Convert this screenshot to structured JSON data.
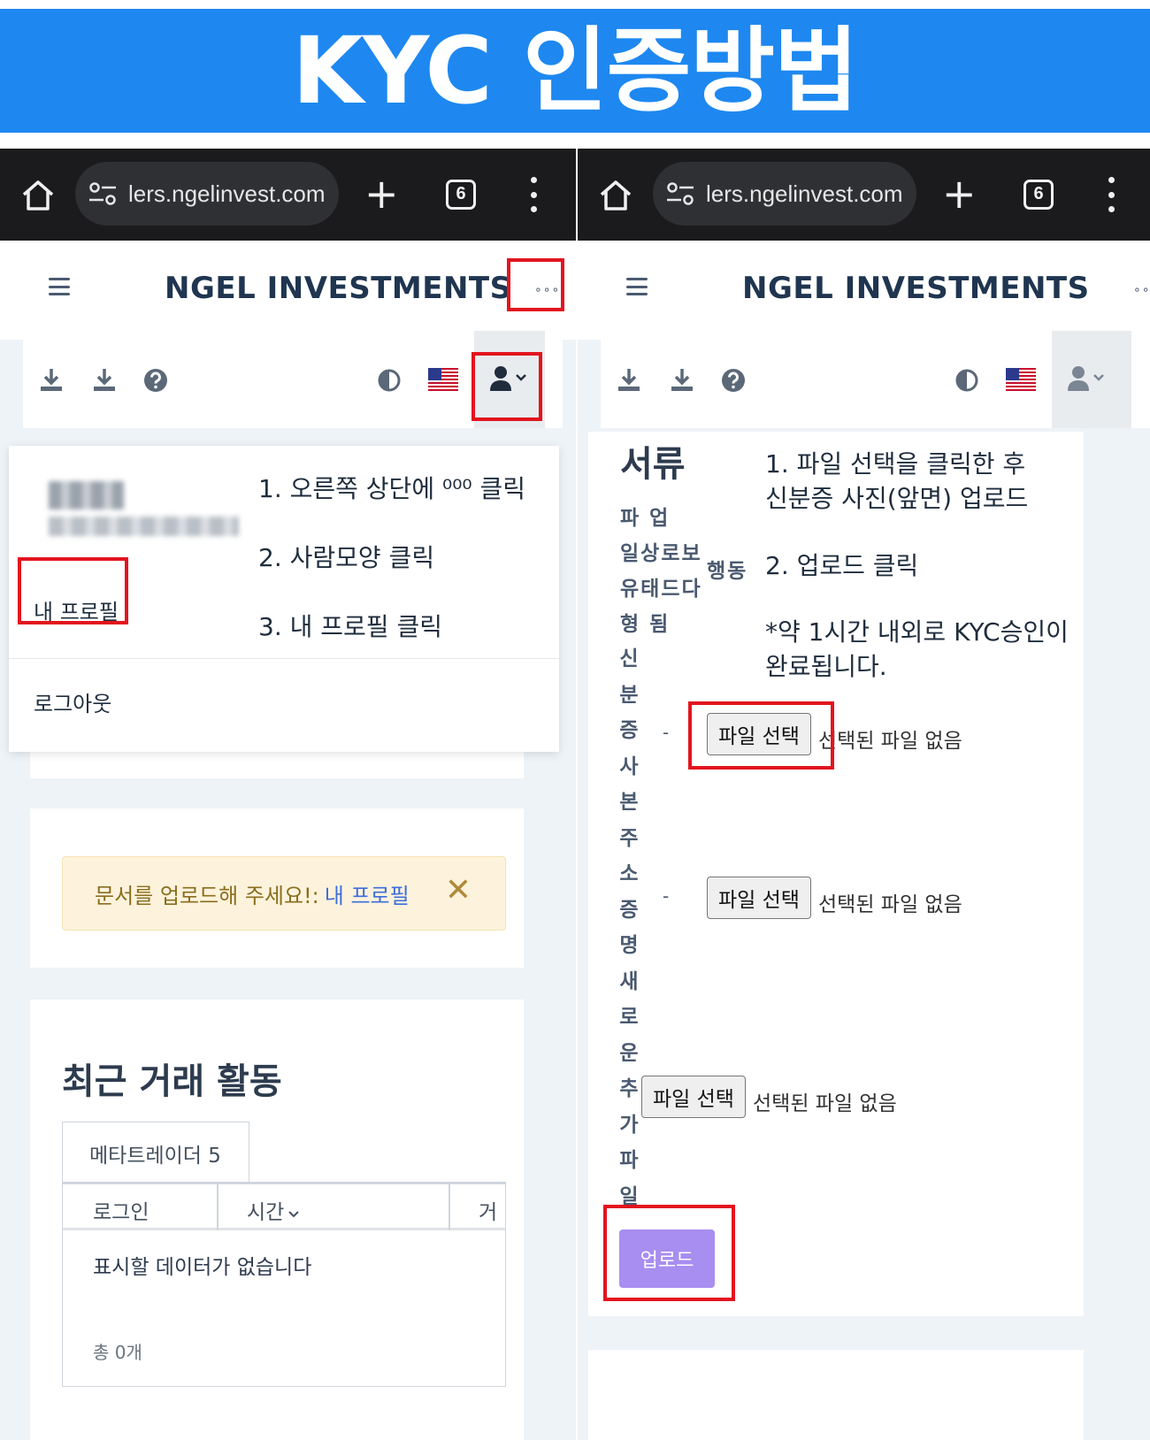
{
  "banner": {
    "title": "KYC 인증방법"
  },
  "browser": {
    "url": "lers.ngelinvest.com",
    "tab_count": "6"
  },
  "site": {
    "brand": "NGEL INVESTMENTS",
    "more": "∘∘∘"
  },
  "left": {
    "menu": {
      "my_profile": "내 프로필",
      "logout": "로그아웃"
    },
    "steps": [
      "1. 오른쪽 상단에 ⁰⁰⁰ 클릭",
      "2. 사람모양 클릭",
      "3. 내 프로필 클릭"
    ],
    "alert": {
      "text": "문서를 업로드해 주세요!:",
      "link": "내 프로필",
      "close": "✕"
    },
    "recent": {
      "title": "최근 거래 활동",
      "tab": "메타트레이더 5",
      "columns": [
        "로그인",
        "시간",
        "거"
      ],
      "empty": "표시할 데이터가 없습니다",
      "total": "총 0개"
    }
  },
  "right": {
    "title": "서류",
    "header_rows": [
      "파 업",
      "일상로보",
      "유태드다",
      "형 됨"
    ],
    "header_side": "행동",
    "col1": [
      "신",
      "분",
      "증",
      "사",
      "본",
      "주",
      "소",
      "증",
      "명",
      "새",
      "로",
      "운"
    ],
    "col2": [
      "추",
      "가",
      "파",
      "일"
    ],
    "dash": "-",
    "file_button": "파일 선택",
    "no_file": "선택된 파일 없음",
    "upload_button": "업로드",
    "steps": [
      "1. 파일 선택을 클릭한 후",
      "신분증 사진(앞면) 업로드",
      "2. 업로드 클릭",
      "*약 1시간 내외로 KYC승인이",
      "완료됩니다."
    ]
  },
  "colors": {
    "banner": "#1e88f0",
    "highlight": "#e3141e",
    "upload": "#a78ef0",
    "alert_bg": "#fdf3dc",
    "brand": "#1f3550"
  }
}
